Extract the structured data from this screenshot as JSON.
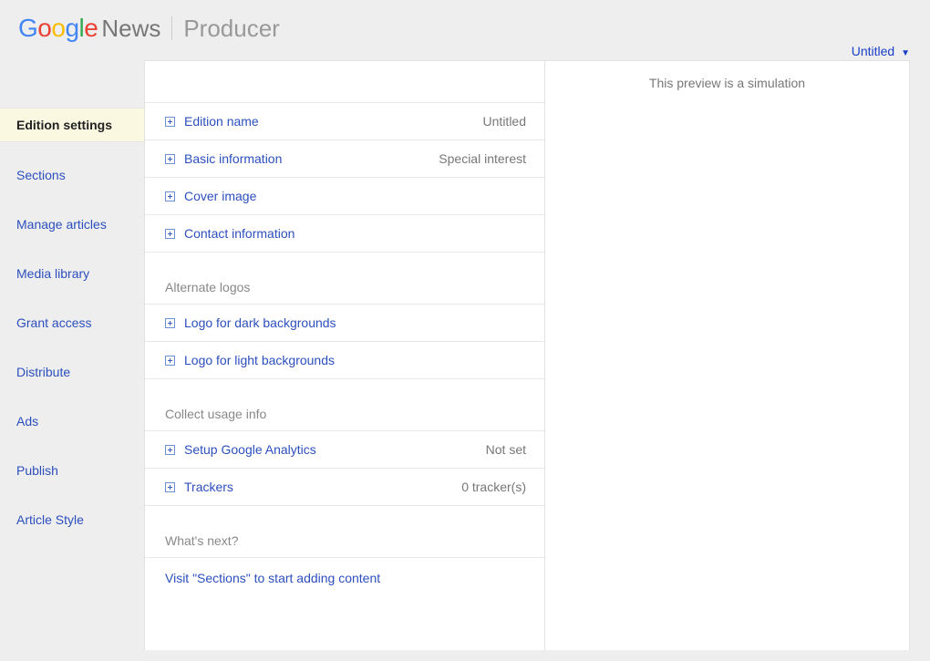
{
  "header": {
    "logo_news": "News",
    "logo_producer": "Producer",
    "dropdown_label": "Untitled"
  },
  "sidebar": {
    "items": [
      {
        "label": "Edition settings",
        "active": true
      },
      {
        "label": "Sections"
      },
      {
        "label": "Manage articles"
      },
      {
        "label": "Media library"
      },
      {
        "label": "Grant access"
      },
      {
        "label": "Distribute"
      },
      {
        "label": "Ads"
      },
      {
        "label": "Publish"
      },
      {
        "label": "Article Style"
      }
    ]
  },
  "main": {
    "rows1": [
      {
        "label": "Edition name",
        "value": "Untitled"
      },
      {
        "label": "Basic information",
        "value": "Special interest"
      },
      {
        "label": "Cover image",
        "value": ""
      },
      {
        "label": "Contact information",
        "value": ""
      }
    ],
    "section_alt_logos": "Alternate logos",
    "rows2": [
      {
        "label": "Logo for dark backgrounds",
        "value": ""
      },
      {
        "label": "Logo for light backgrounds",
        "value": ""
      }
    ],
    "section_usage": "Collect usage info",
    "rows3": [
      {
        "label": "Setup Google Analytics",
        "value": "Not set"
      },
      {
        "label": "Trackers",
        "value": "0 tracker(s)"
      }
    ],
    "section_next": "What's next?",
    "next_link": "Visit \"Sections\" to start adding content"
  },
  "preview": {
    "message": "This preview is a simulation"
  }
}
